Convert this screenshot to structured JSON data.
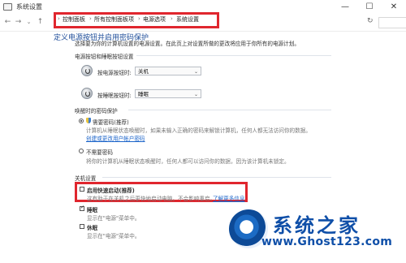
{
  "window": {
    "title": "系统设置",
    "controls": [
      "—",
      "☐",
      "✕"
    ]
  },
  "breadcrumb": [
    "控制面板",
    "所有控制面板项",
    "电源选项",
    "系统设置"
  ],
  "top_partial_heading": "定义电源按钮并启用密码保护",
  "description": "选择要为你的计算机设置的电源设置。在此页上对设置所做的更改将应用于你所有的电源计划。",
  "power_buttons": {
    "section_title": "电源按钮和睡眠按钮设置",
    "power_label": "按电源按钮时:",
    "power_value": "关机",
    "sleep_label": "按睡眠按钮时:",
    "sleep_value": "睡眠"
  },
  "wake_password": {
    "section_title": "唤醒时的密码保护",
    "option_require": "需要密码(推荐)",
    "require_desc": "计算机从睡眠状态唤醒时，如果未输入正确的密码来解锁计算机，任何人都无法访问你的数据。",
    "require_link": "创建或更改用户帐户密码",
    "option_no": "不需要密码",
    "no_desc": "将你的计算机从睡眠状态唤醒时，任何人都可以访问你的数据，因为该计算机未锁定。"
  },
  "shutdown": {
    "section_title": "关机设置",
    "fast_startup_label": "启用快速启动(推荐)",
    "fast_startup_desc": "这有助于在关机之后更快地启动电脑。不会影响重启。",
    "fast_startup_link": "了解更多信息",
    "sleep_label": "睡眠",
    "sleep_desc": "显示在\"电源\"菜单中。",
    "hibernate_label": "休眠",
    "hibernate_desc": "显示在\"电源\"菜单中。"
  },
  "watermark": {
    "title": "系统之家",
    "url": "www.Ghost123.com"
  },
  "colors": {
    "highlight": "#e0262e",
    "link": "#1a63c9",
    "watermark": "#0f4fa8"
  }
}
